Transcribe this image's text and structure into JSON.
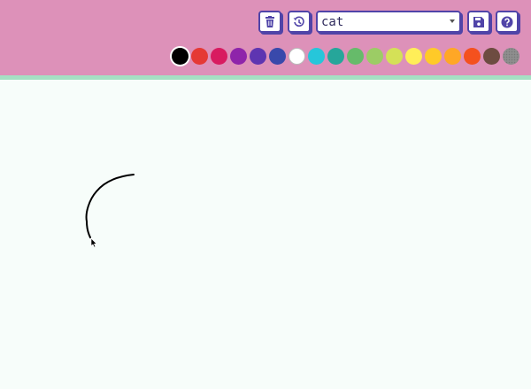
{
  "toolbar": {
    "clear_button": {
      "icon": "trash-icon"
    },
    "history_button": {
      "icon": "history-icon"
    },
    "category_select": {
      "value": "cat"
    },
    "save_button": {
      "icon": "save-icon"
    },
    "help_button": {
      "icon": "help-icon"
    }
  },
  "palette": {
    "selected": "#000000",
    "colors": [
      "#000000",
      "#e53935",
      "#d81b60",
      "#8e24aa",
      "#5e35b1",
      "#3949ab",
      "#ffffff",
      "#26c6da",
      "#26a69a",
      "#66bb6a",
      "#9ccc65",
      "#d4e157",
      "#ffee58",
      "#ffca28",
      "#ffa726",
      "#f4511e",
      "#6d4c41",
      "pattern"
    ]
  },
  "accent_color": "#5044a8",
  "toolbar_color": "#dd91b9"
}
